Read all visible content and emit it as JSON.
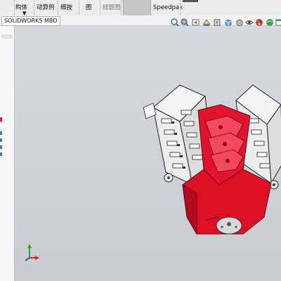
{
  "ribbon": {
    "buttons": [
      {
        "id": "part",
        "line1": "",
        "line2": "构体"
      },
      {
        "id": "motion",
        "line1": "",
        "line2": "动算例"
      },
      {
        "id": "zoom",
        "line1": "",
        "line2": "细按"
      },
      {
        "id": "view1",
        "line1": "",
        "line2": "图"
      },
      {
        "id": "view2",
        "line1": "",
        "line2": "线题图"
      },
      {
        "id": "speedpak",
        "line1": "",
        "line2": "Speedpak"
      }
    ]
  },
  "tabs": {
    "active": "SOLIDWORKS MBD"
  },
  "heads_up_toolbar": {
    "icons": [
      "zoom-to-fit-icon",
      "zoom-area-icon",
      "previous-view-icon",
      "section-view-icon",
      "dynamic-annotation-icon",
      "view-orientation-icon",
      "display-style-icon",
      "hide-show-icon",
      "edit-appearance-icon",
      "apply-scene-icon",
      "view-settings-icon"
    ]
  },
  "colors": {
    "viewport_top": "#d6d9de",
    "viewport_bottom": "#c9ccd1",
    "engine_red": "#e0142c",
    "engine_white": "#f5f5f5"
  }
}
